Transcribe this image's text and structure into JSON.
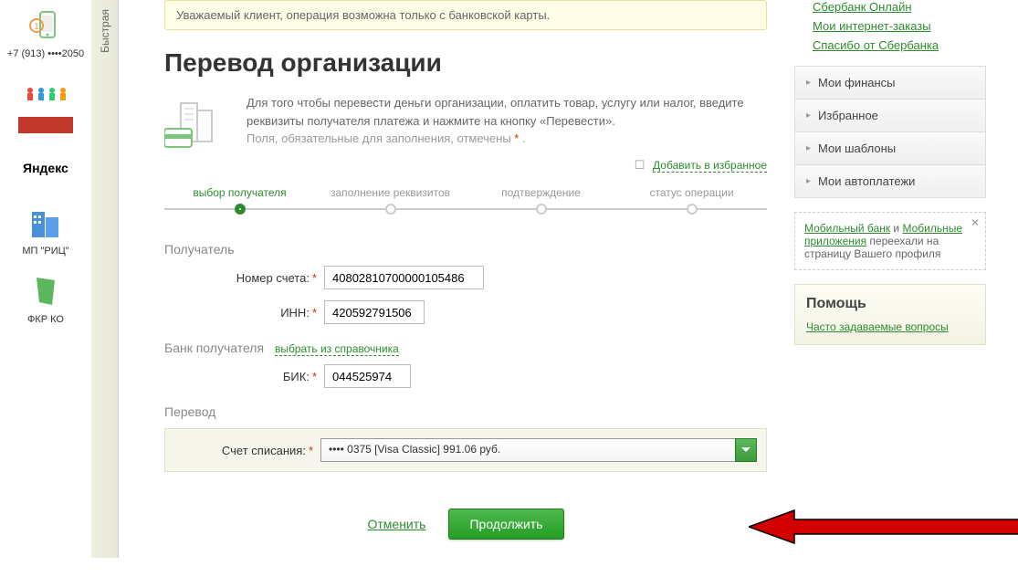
{
  "left_sidebar": {
    "phone": "+7 (913) ••••2050",
    "items": [
      "",
      "",
      "Яндекс",
      "МП \"РИЦ\"",
      "ФКР КО"
    ]
  },
  "vertical_tab": "Быстрая",
  "alert": "Уважаемый клиент, операция возможна только с банковской карты.",
  "title": "Перевод организации",
  "intro": {
    "line1": "Для того чтобы перевести деньги организации, оплатить товар, услугу или налог, введите реквизиты получателя платежа и нажмите на кнопку «Перевести».",
    "line2": "Поля, обязательные для заполнения, отмечены ",
    "star": "*",
    "dot": " ."
  },
  "fav_link": "Добавить в избранное",
  "steps": [
    "выбор получателя",
    "заполнение реквизитов",
    "подтверждение",
    "статус операции"
  ],
  "sections": {
    "recipient": "Получатель",
    "bank": "Банк получателя",
    "bank_link": "выбрать из справочника",
    "transfer": "Перевод"
  },
  "labels": {
    "account": "Номер счета:",
    "inn": "ИНН:",
    "bik": "БИК:",
    "debit_account": "Счет списания:"
  },
  "values": {
    "account": "40802810700000105486",
    "inn": "420592791506",
    "bik": "044525974",
    "debit_account": "•••• 0375 [Visa Classic] 991.06 руб."
  },
  "actions": {
    "cancel": "Отменить",
    "submit": "Продолжить"
  },
  "right": {
    "top_links": [
      "Сбербанк Онлайн",
      "Мои интернет-заказы",
      "Спасибо от Сбербанка"
    ],
    "accordion": [
      "Мои финансы",
      "Избранное",
      "Мои шаблоны",
      "Мои автоплатежи"
    ],
    "notice": {
      "link1": "Мобильный банк",
      "and": " и ",
      "link2": "Мобильные приложения",
      "text": " переехали на страницу Вашего профиля"
    },
    "help": {
      "title": "Помощь",
      "link": "Часто задаваемые вопросы"
    }
  }
}
